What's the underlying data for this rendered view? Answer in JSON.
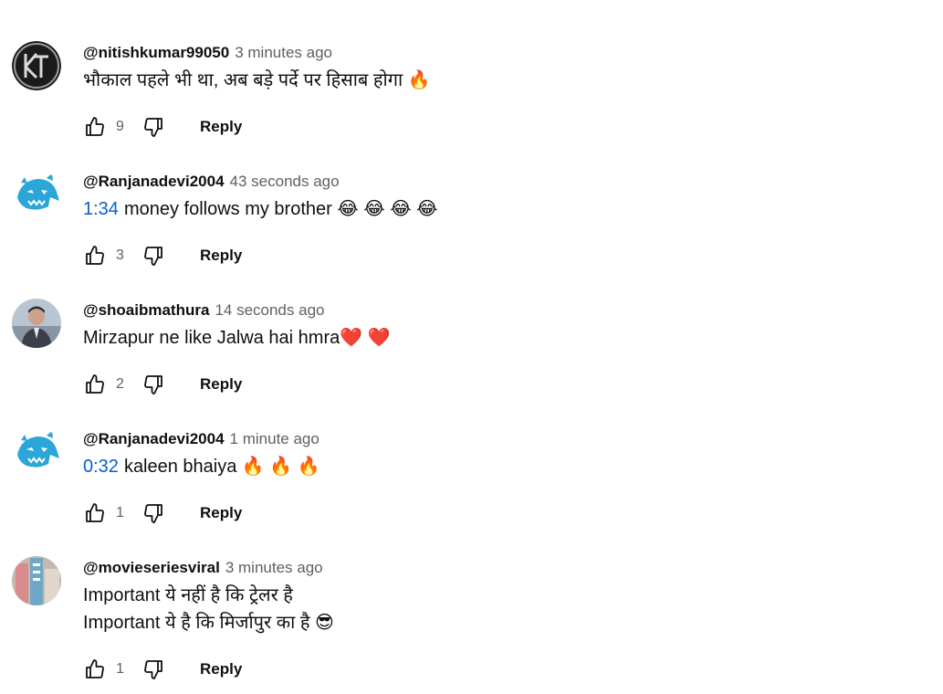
{
  "comments": [
    {
      "author": "@nitishkumar99050",
      "time": "3 minutes ago",
      "timestamp": "",
      "lines": [
        "भौकाल पहले भी था, अब बड़े पर्दे पर हिसाब होगा 🔥"
      ],
      "likes": "9",
      "reply_label": "Reply",
      "avatar": "kt-logo-avatar"
    },
    {
      "author": "@Ranjanadevi2004",
      "time": "43 seconds ago",
      "timestamp": "1:34",
      "lines": [
        "money follows my brother 😂 😂 😂 😂"
      ],
      "likes": "3",
      "reply_label": "Reply",
      "avatar": "beast-avatar"
    },
    {
      "author": "@shoaibmathura",
      "time": "14 seconds ago",
      "timestamp": "",
      "lines": [
        "Mirzapur ne like Jalwa hai hmra❤️ ❤️"
      ],
      "likes": "2",
      "reply_label": "Reply",
      "avatar": "person-avatar"
    },
    {
      "author": "@Ranjanadevi2004",
      "time": "1 minute ago",
      "timestamp": "0:32",
      "lines": [
        "kaleen bhaiya 🔥 🔥 🔥"
      ],
      "likes": "1",
      "reply_label": "Reply",
      "avatar": "beast-avatar"
    },
    {
      "author": "@movieseriesviral",
      "time": "3 minutes ago",
      "timestamp": "",
      "lines": [
        "Important ये नहीं है कि ट्रेलर है",
        "Important ये है कि मिर्जापुर का है 😎"
      ],
      "likes": "1",
      "reply_label": "Reply",
      "avatar": "building-avatar"
    }
  ],
  "icons": {
    "like": "thumbs-up-icon",
    "dislike": "thumbs-down-icon"
  },
  "colors": {
    "timestamp_link": "#065fd4",
    "meta": "#606060",
    "text": "#0f0f0f"
  }
}
